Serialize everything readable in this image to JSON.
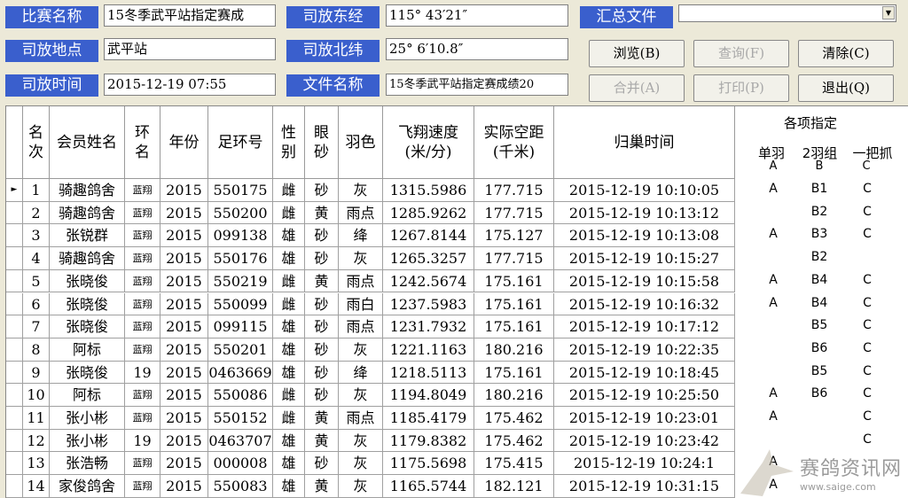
{
  "form": {
    "race_name_label": "比赛名称",
    "race_name_value": "15冬季武平站指定赛成",
    "location_label": "司放地点",
    "location_value": "武平站",
    "time_label": "司放时间",
    "time_value": "2015-12-19 07:55",
    "longitude_label": "司放东经",
    "longitude_value": "115° 43′21″",
    "latitude_label": "司放北纬",
    "latitude_value": "25° 6′10.8″",
    "filename_label": "文件名称",
    "filename_value": "15冬季武平站指定赛成绩20",
    "summary_label": "汇总文件",
    "summary_value": ""
  },
  "buttons": {
    "browse": "浏览(B)",
    "query": "查询(F)",
    "clear": "清除(C)",
    "merge": "合并(A)",
    "print": "打印(P)",
    "exit": "退出(Q)"
  },
  "table": {
    "headers": {
      "rank": "名次",
      "member": "会员姓名",
      "ring_type": "环名",
      "year": "年份",
      "ring_no": "足环号",
      "sex": "性别",
      "eye": "眼砂",
      "color": "羽色",
      "speed": "飞翔速度(米/分)",
      "distance": "实际空距(千米)",
      "arrival": "归巢时间",
      "assign": "各项指定",
      "assign_single": "单羽",
      "assign_single_code": "A",
      "assign_pair": "2羽组",
      "assign_pair_code": "B",
      "assign_grab": "一把抓",
      "assign_grab_code": "C"
    },
    "rows": [
      {
        "rank": "1",
        "member": "骑趣鸽舍",
        "ring_type": "蓝翔",
        "year": "2015",
        "ring_no": "550175",
        "sex": "雌",
        "eye": "砂",
        "color": "灰",
        "speed": "1315.5986",
        "distance": "177.715",
        "arrival": "2015-12-19  10:10:05",
        "a": "A",
        "b": "B1",
        "c": "C"
      },
      {
        "rank": "2",
        "member": "骑趣鸽舍",
        "ring_type": "蓝翔",
        "year": "2015",
        "ring_no": "550200",
        "sex": "雌",
        "eye": "黄",
        "color": "雨点",
        "speed": "1285.9262",
        "distance": "177.715",
        "arrival": "2015-12-19  10:13:12",
        "a": "",
        "b": "B2",
        "c": "C"
      },
      {
        "rank": "3",
        "member": "张锐群",
        "ring_type": "蓝翔",
        "year": "2015",
        "ring_no": "099138",
        "sex": "雄",
        "eye": "砂",
        "color": "绛",
        "speed": "1267.8144",
        "distance": "175.127",
        "arrival": "2015-12-19  10:13:08",
        "a": "A",
        "b": "B3",
        "c": "C"
      },
      {
        "rank": "4",
        "member": "骑趣鸽舍",
        "ring_type": "蓝翔",
        "year": "2015",
        "ring_no": "550176",
        "sex": "雄",
        "eye": "砂",
        "color": "灰",
        "speed": "1265.3257",
        "distance": "177.715",
        "arrival": "2015-12-19  10:15:27",
        "a": "",
        "b": "B2",
        "c": ""
      },
      {
        "rank": "5",
        "member": "张晓俊",
        "ring_type": "蓝翔",
        "year": "2015",
        "ring_no": "550219",
        "sex": "雌",
        "eye": "黄",
        "color": "雨点",
        "speed": "1242.5674",
        "distance": "175.161",
        "arrival": "2015-12-19  10:15:58",
        "a": "A",
        "b": "B4",
        "c": "C"
      },
      {
        "rank": "6",
        "member": "张晓俊",
        "ring_type": "蓝翔",
        "year": "2015",
        "ring_no": "550099",
        "sex": "雌",
        "eye": "砂",
        "color": "雨白",
        "speed": "1237.5983",
        "distance": "175.161",
        "arrival": "2015-12-19  10:16:32",
        "a": "A",
        "b": "B4",
        "c": "C"
      },
      {
        "rank": "7",
        "member": "张晓俊",
        "ring_type": "蓝翔",
        "year": "2015",
        "ring_no": "099115",
        "sex": "雄",
        "eye": "砂",
        "color": "雨点",
        "speed": "1231.7932",
        "distance": "175.161",
        "arrival": "2015-12-19  10:17:12",
        "a": "",
        "b": "B5",
        "c": "C"
      },
      {
        "rank": "8",
        "member": "阿标",
        "ring_type": "蓝翔",
        "year": "2015",
        "ring_no": "550201",
        "sex": "雄",
        "eye": "砂",
        "color": "灰",
        "speed": "1221.1163",
        "distance": "180.216",
        "arrival": "2015-12-19  10:22:35",
        "a": "",
        "b": "B6",
        "c": "C"
      },
      {
        "rank": "9",
        "member": "张晓俊",
        "ring_type": "19",
        "year": "2015",
        "ring_no": "0463669",
        "sex": "雄",
        "eye": "砂",
        "color": "绛",
        "speed": "1218.5113",
        "distance": "175.161",
        "arrival": "2015-12-19  10:18:45",
        "a": "",
        "b": "B5",
        "c": "C"
      },
      {
        "rank": "10",
        "member": "阿标",
        "ring_type": "蓝翔",
        "year": "2015",
        "ring_no": "550086",
        "sex": "雌",
        "eye": "砂",
        "color": "灰",
        "speed": "1194.8049",
        "distance": "180.216",
        "arrival": "2015-12-19  10:25:50",
        "a": "A",
        "b": "B6",
        "c": "C"
      },
      {
        "rank": "11",
        "member": "张小彬",
        "ring_type": "蓝翔",
        "year": "2015",
        "ring_no": "550152",
        "sex": "雌",
        "eye": "黄",
        "color": "雨点",
        "speed": "1185.4179",
        "distance": "175.462",
        "arrival": "2015-12-19  10:23:01",
        "a": "A",
        "b": "",
        "c": "C"
      },
      {
        "rank": "12",
        "member": "张小彬",
        "ring_type": "19",
        "year": "2015",
        "ring_no": "0463707",
        "sex": "雄",
        "eye": "黄",
        "color": "灰",
        "speed": "1179.8382",
        "distance": "175.462",
        "arrival": "2015-12-19  10:23:42",
        "a": "",
        "b": "",
        "c": "C"
      },
      {
        "rank": "13",
        "member": "张浩畅",
        "ring_type": "蓝翔",
        "year": "2015",
        "ring_no": "000008",
        "sex": "雄",
        "eye": "砂",
        "color": "灰",
        "speed": "1175.5698",
        "distance": "175.415",
        "arrival": "2015-12-19  10:24:1",
        "a": "A",
        "b": "",
        "c": ""
      },
      {
        "rank": "14",
        "member": "家俊鸽舍",
        "ring_type": "蓝翔",
        "year": "2015",
        "ring_no": "550083",
        "sex": "雄",
        "eye": "黄",
        "color": "灰",
        "speed": "1165.5744",
        "distance": "182.121",
        "arrival": "2015-12-19  10:31:15",
        "a": "A",
        "b": "",
        "c": ""
      }
    ]
  },
  "watermark": {
    "name": "赛鸽资讯网",
    "url": "www.saige.com"
  }
}
